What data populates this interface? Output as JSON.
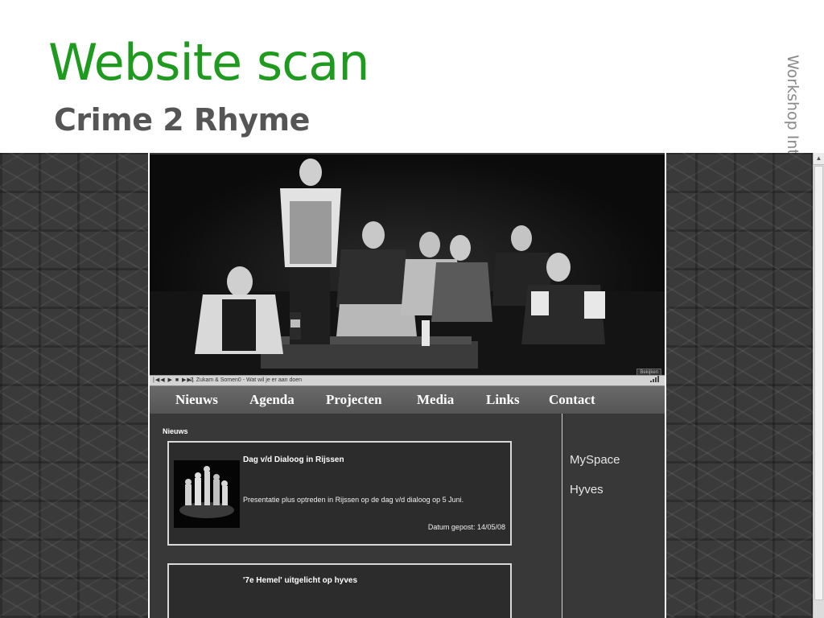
{
  "slide": {
    "title": "Website scan",
    "subtitle": "Crime 2 Rhyme",
    "side_caption": "Workshop Internet marketing “Scoren met het internet”"
  },
  "player": {
    "controls": "|◀◀ ▶ ■ ▶▶|",
    "track": "2.    Zukam & Somen0 - Wat wil je er aan doen",
    "level_icon": "signal-bars-icon"
  },
  "hero": {
    "badge": "Bekijken"
  },
  "nav": {
    "items": [
      {
        "label": "Nieuws"
      },
      {
        "label": "Agenda"
      },
      {
        "label": "Projecten"
      },
      {
        "label": "Media"
      },
      {
        "label": "Links"
      },
      {
        "label": "Contact"
      }
    ]
  },
  "news": {
    "section_label": "Nieuws",
    "items": [
      {
        "title": "Dag v/d Dialoog in Rijssen",
        "body": "Presentatie plus optreden in Rijssen op de dag v/d dialoog op 5 Juni.",
        "date": "Datum gepost: 14/05/08"
      },
      {
        "title": "'7e Hemel' uitgelicht op hyves"
      }
    ]
  },
  "sidebar": {
    "links": [
      {
        "label": "MySpace"
      },
      {
        "label": "Hyves"
      }
    ]
  },
  "colors": {
    "title_green": "#1e9a1e",
    "subtitle_gray": "#555555",
    "site_background": "#383838",
    "nav_background": "#5e5e5e"
  }
}
